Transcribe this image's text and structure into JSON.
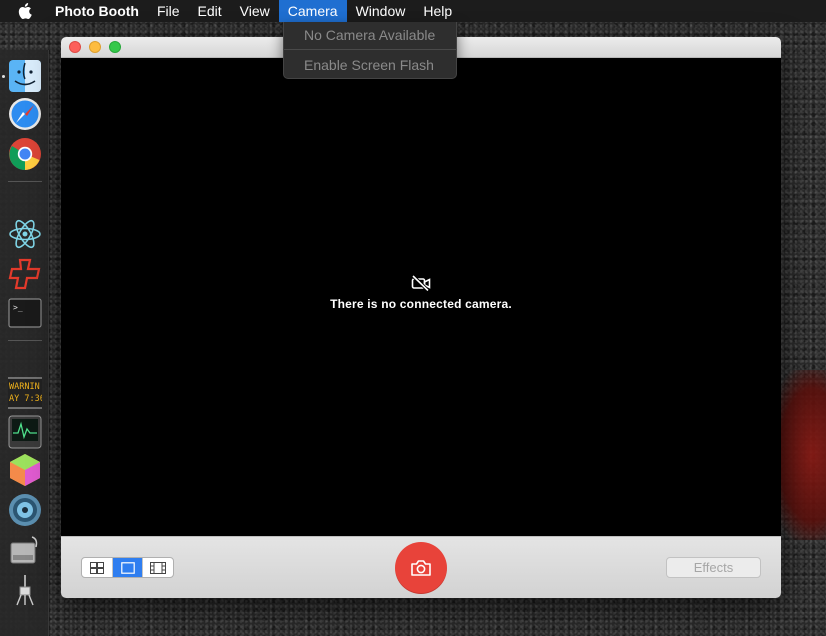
{
  "menubar": {
    "apple": "apple-logo-icon",
    "app_name": "Photo Booth",
    "items": [
      "File",
      "Edit",
      "View",
      "Camera",
      "Window",
      "Help"
    ],
    "active": "Camera"
  },
  "camera_menu": {
    "items": [
      "No Camera Available",
      "Enable Screen Flash"
    ]
  },
  "dock": {
    "icons": [
      "finder-icon",
      "safari-icon",
      "chrome-icon",
      "atom-icon",
      "plus-app-icon",
      "terminal-icon",
      "console-icon",
      "activity-monitor-icon",
      "grapher-icon",
      "disk-utility-icon",
      "boot-camp-icon",
      "usb-cable-icon"
    ],
    "console_text": [
      "WARNIN",
      "AY 7:36"
    ]
  },
  "window": {
    "camera_message": "There is no connected camera.",
    "effects_label": "Effects",
    "view_modes": [
      "grid-view",
      "single-photo-view",
      "video-view"
    ],
    "selected_view_mode": "single-photo-view"
  },
  "colors": {
    "menu_highlight": "#1f6fd1",
    "shutter": "#e8433a",
    "segment_selected": "#2f7ef0"
  }
}
